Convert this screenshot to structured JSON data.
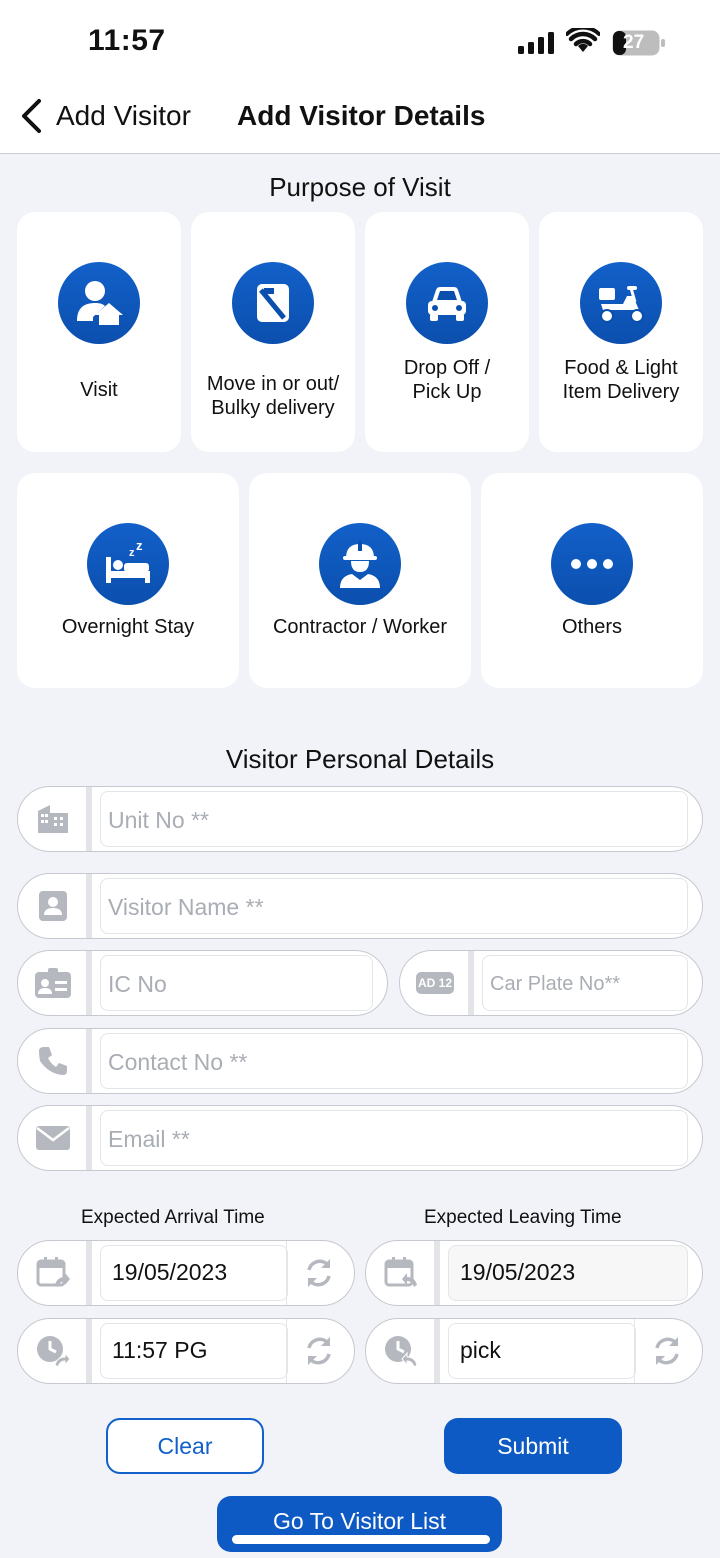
{
  "status_bar": {
    "time": "11:57",
    "battery": "27"
  },
  "nav": {
    "back_label": "Add Visitor",
    "title": "Add Visitor Details"
  },
  "purpose": {
    "title": "Purpose of Visit",
    "items": [
      {
        "label": "Visit",
        "icon": "visitor-home-icon"
      },
      {
        "label": "Move in or out/\nBulky delivery",
        "icon": "moving-box-icon"
      },
      {
        "label": "Drop Off /\nPick Up",
        "icon": "car-icon"
      },
      {
        "label": "Food & Light\nItem Delivery",
        "icon": "scooter-icon"
      },
      {
        "label": "Overnight Stay",
        "icon": "bed-sleep-icon"
      },
      {
        "label": "Contractor / Worker",
        "icon": "worker-helmet-icon"
      },
      {
        "label": "Others",
        "icon": "more-dots-icon"
      }
    ]
  },
  "personal": {
    "title": "Visitor Personal Details",
    "unit_placeholder": "Unit No **",
    "name_placeholder": "Visitor Name **",
    "ic_placeholder": "IC No",
    "car_plate_placeholder": "Car Plate No**",
    "car_plate_icon_text": "AD 12",
    "contact_placeholder": "Contact No **",
    "email_placeholder": "Email **"
  },
  "times": {
    "arrival_label": "Expected Arrival Time",
    "leaving_label": "Expected Leaving Time",
    "arrival_date": "19/05/2023",
    "arrival_time": "11:57 PG",
    "leaving_date": "19/05/2023",
    "leaving_time": "pick"
  },
  "buttons": {
    "clear": "Clear",
    "submit": "Submit",
    "visitor_list": "Go To Visitor List"
  },
  "colors": {
    "accent": "#0e5ac4",
    "background": "#f1f3f8",
    "icon_gray": "#a9adb4"
  }
}
